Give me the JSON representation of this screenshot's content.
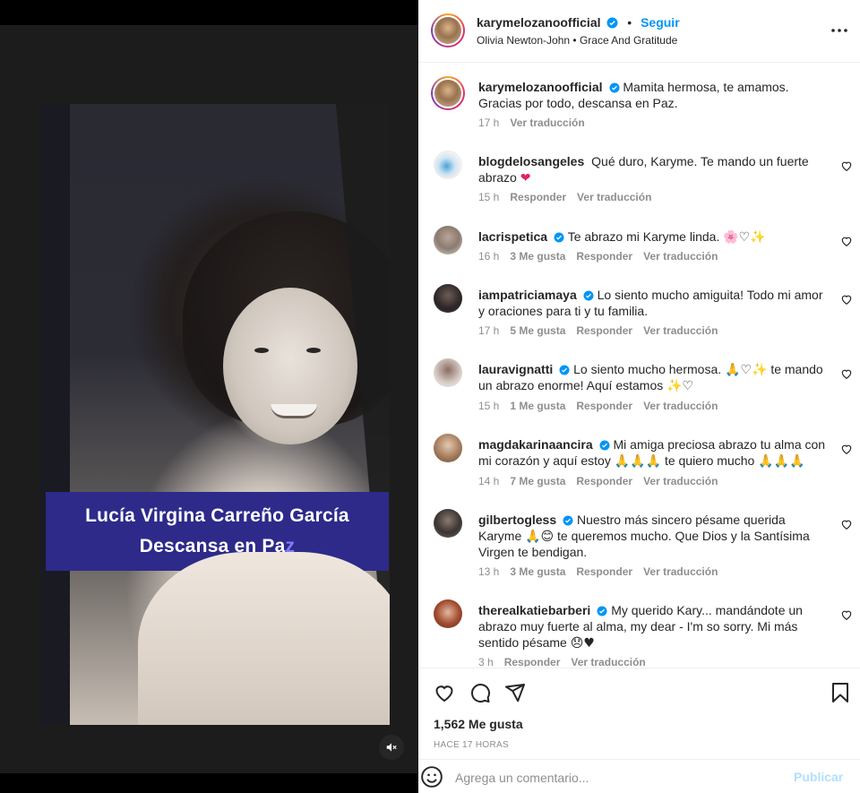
{
  "post": {
    "caption_lines": [
      "Lucía Virgina Carreño García",
      "Descansa en Pa",
      "z"
    ],
    "photo_description_icon": "mute-icon"
  },
  "header": {
    "username": "karymelozanoofficial",
    "separator": "•",
    "follow_label": "Seguir",
    "audio": "Olivia Newton-John",
    "audio_separator": "•",
    "audio_track": "Grace And Gratitude",
    "more_icon": "more-horizontal-icon"
  },
  "comments": [
    {
      "username": "karymelozanoofficial",
      "verified": true,
      "text_lines": [
        "Mamita hermosa, te amamos. Gracias",
        "por todo, descansa en Paz."
      ],
      "time": "17 h",
      "likes": "",
      "reply": "",
      "translate": "Ver traducción",
      "is_caption": true
    },
    {
      "username": "blogdelosangeles",
      "verified": false,
      "text": "Qué duro, Karyme. Te mando un fuerte abrazo",
      "emoji": "❤",
      "time": "15 h",
      "likes": "",
      "reply": "Responder",
      "translate": "Ver traducción"
    },
    {
      "username": "lacrispetica",
      "verified": true,
      "text": "Te abrazo mi Karyme linda.",
      "emoji": "🌸♡✨",
      "time": "16 h",
      "likes": "3 Me gusta",
      "reply": "Responder",
      "translate": "Ver traducción"
    },
    {
      "username": "iampatriciamaya",
      "verified": true,
      "text": "Lo siento mucho amiguita! Todo mi amor y oraciones para ti y tu familia.",
      "time": "17 h",
      "likes": "5 Me gusta",
      "reply": "Responder",
      "translate": "Ver traducción"
    },
    {
      "username": "lauravignatti",
      "verified": true,
      "text": "Lo siento mucho hermosa.",
      "emoji": "🙏♡✨",
      "text2": "te mando un abrazo enorme! Aquí estamos",
      "emoji2": "✨♡",
      "time": "15 h",
      "likes": "1 Me gusta",
      "reply": "Responder",
      "translate": "Ver traducción"
    },
    {
      "username": "magdakarinaancira",
      "verified": true,
      "text": "Mi amiga preciosa abrazo tu alma con mi corazón y aquí estoy",
      "emoji": "🙏🙏🙏",
      "text2": "te quiero mucho",
      "emoji2": "🙏🙏🙏",
      "time": "14 h",
      "likes": "7 Me gusta",
      "reply": "Responder",
      "translate": "Ver traducción"
    },
    {
      "username": "gilbertogless",
      "verified": true,
      "text": "Nuestro más sincero pésame querida Karyme",
      "emoji": "🙏😊",
      "text2": "te queremos mucho. Que Dios y la Santísima Virgen te bendigan.",
      "time": "13 h",
      "likes": "3 Me gusta",
      "reply": "Responder",
      "translate": "Ver traducción"
    },
    {
      "username": "therealkatiebarberi",
      "verified": true,
      "text": "My querido Kary... mandándote un abrazo muy fuerte al alma, my dear - I'm so sorry. Mi más sentido pésame",
      "emoji": "😞♥",
      "time": "3 h",
      "likes": "",
      "reply": "Responder",
      "translate": "Ver traducción"
    }
  ],
  "actions": {
    "like_icon": "heart-icon",
    "comment_icon": "comment-icon",
    "share_icon": "share-icon",
    "save_icon": "bookmark-icon",
    "likes_count": "1,562 Me gusta",
    "time_ago": "HACE 17 HORAS"
  },
  "composer": {
    "placeholder": "Agrega un comentario...",
    "publish_label": "Publicar",
    "emoji_icon": "emoji-icon"
  },
  "colors": {
    "accent": "#0095f6",
    "publish_disabled": "#b2dffc",
    "caption_bg": "#2d2a8a",
    "verified": "#0095f6"
  }
}
